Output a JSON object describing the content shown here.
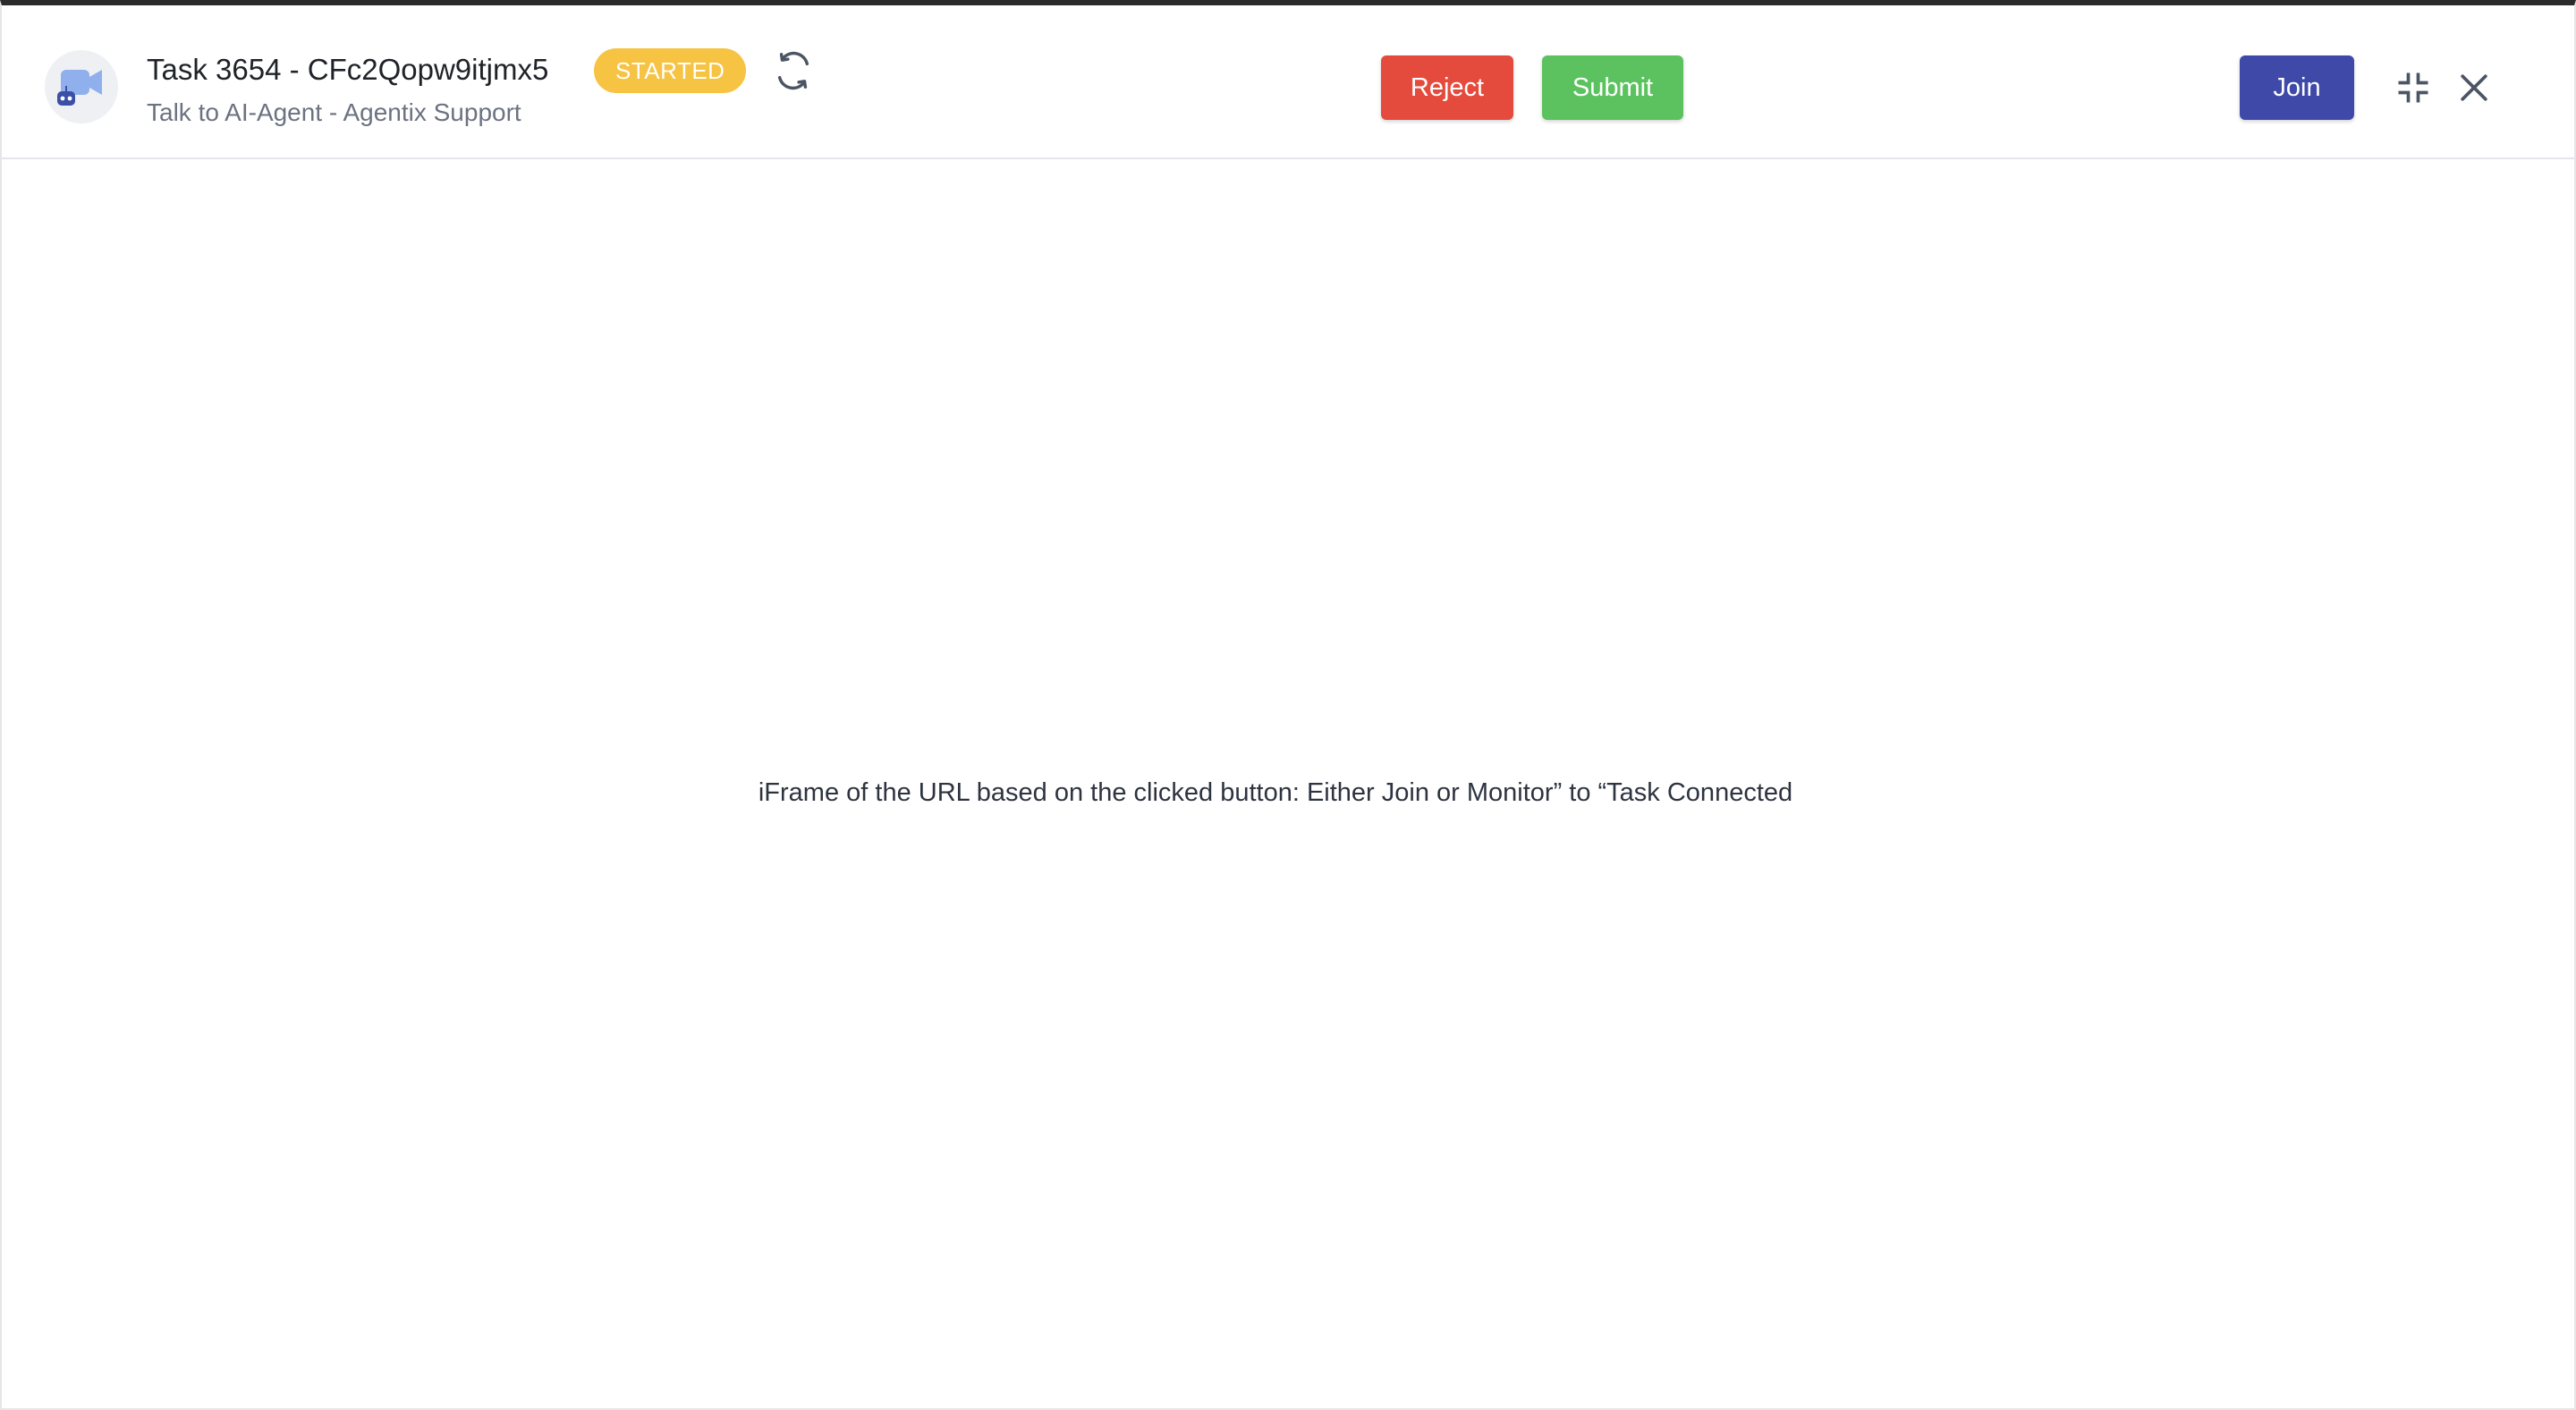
{
  "header": {
    "title": "Task 3654 - CFc2Qopw9itjmx5",
    "subtitle": "Talk to AI-Agent - Agentix Support",
    "status_badge": "STARTED",
    "avatar_icon": "video-camera-robot-icon",
    "refresh_icon": "refresh-icon",
    "reject_label": "Reject",
    "submit_label": "Submit",
    "join_label": "Join",
    "minimize_icon": "minimize-icon",
    "close_icon": "close-icon"
  },
  "main": {
    "placeholder_text": "iFrame of the URL based on the clicked button: Either Join or Monitor” to “Task Connected"
  },
  "colors": {
    "badge": "#f6c343",
    "reject": "#e54b3c",
    "submit": "#5cc25f",
    "join": "#3f4aa8"
  }
}
